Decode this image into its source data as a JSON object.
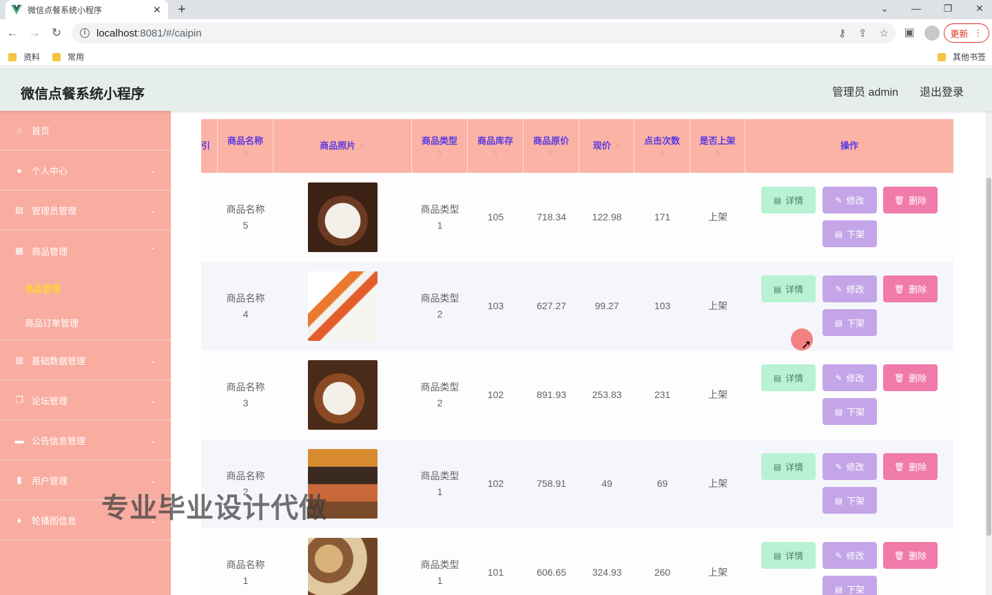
{
  "browser": {
    "tab_title": "微信点餐系统小程序",
    "url_host": "localhost",
    "url_path": ":8081/#/caipin",
    "update_label": "更新",
    "bookmarks": [
      "资料",
      "常用"
    ],
    "other_bookmarks": "其他书签"
  },
  "header": {
    "title": "微信点餐系统小程序",
    "user": "管理员 admin",
    "logout": "退出登录"
  },
  "sidebar": {
    "items": [
      {
        "label": "首页",
        "icon": "home-icon"
      },
      {
        "label": "个人中心",
        "icon": "user-icon"
      },
      {
        "label": "管理员管理",
        "icon": "card-icon"
      },
      {
        "label": "商品管理",
        "icon": "grid-icon"
      },
      {
        "label": "基础数据管理",
        "icon": "table-icon"
      },
      {
        "label": "论坛管理",
        "icon": "copy-icon"
      },
      {
        "label": "公告信息管理",
        "icon": "chat-icon"
      },
      {
        "label": "用户管理",
        "icon": "chart-icon"
      },
      {
        "label": "轮播图信息",
        "icon": "mic-icon"
      }
    ],
    "subitems": [
      {
        "label": "商品管理",
        "active": true
      },
      {
        "label": "商品订单管理",
        "active": false
      }
    ]
  },
  "table": {
    "headers": {
      "index": "引",
      "name": "商品名称",
      "photo": "商品照片",
      "type": "商品类型",
      "stock": "商品库存",
      "orig_price": "商品原价",
      "price": "现价",
      "clicks": "点击次数",
      "on_shelf": "是否上架",
      "ops": "操作"
    },
    "buttons": {
      "detail": "详情",
      "edit": "修改",
      "delete": "删除",
      "off_shelf": "下架"
    },
    "rows": [
      {
        "name_1": "商品名称",
        "name_2": "5",
        "type_1": "商品类型",
        "type_2": "1",
        "stock": "105",
        "orig_price": "718.34",
        "price": "122.98",
        "clicks": "171",
        "on_shelf": "上架"
      },
      {
        "name_1": "商品名称",
        "name_2": "4",
        "type_1": "商品类型",
        "type_2": "2",
        "stock": "103",
        "orig_price": "627.27",
        "price": "99.27",
        "clicks": "103",
        "on_shelf": "上架"
      },
      {
        "name_1": "商品名称",
        "name_2": "3",
        "type_1": "商品类型",
        "type_2": "2",
        "stock": "102",
        "orig_price": "891.93",
        "price": "253.83",
        "clicks": "231",
        "on_shelf": "上架"
      },
      {
        "name_1": "商品名称",
        "name_2": "2",
        "type_1": "商品类型",
        "type_2": "1",
        "stock": "102",
        "orig_price": "758.91",
        "price": "49",
        "clicks": "69",
        "on_shelf": "上架"
      },
      {
        "name_1": "商品名称",
        "name_2": "1",
        "type_1": "商品类型",
        "type_2": "1",
        "stock": "101",
        "orig_price": "606.65",
        "price": "324.93",
        "clicks": "260",
        "on_shelf": "上架"
      }
    ]
  },
  "watermark": "专业毕业设计代做",
  "colors": {
    "sidebar": "#f9aca0",
    "table_header": "#fbb3a6",
    "header_text": "#5b3ae0",
    "btn_detail": "#b8f2d3",
    "btn_edit": "#c4a6e8",
    "btn_delete": "#f07aa9",
    "active_subitem": "#ffea00"
  }
}
